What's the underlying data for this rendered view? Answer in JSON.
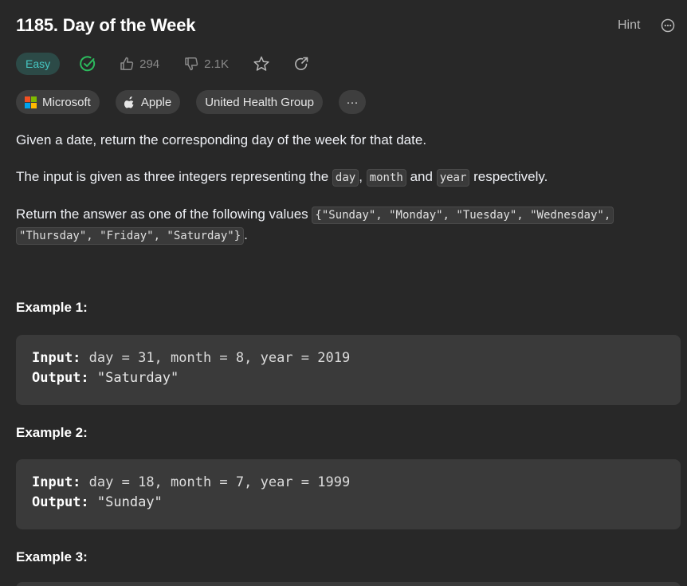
{
  "problem": {
    "title": "1185. Day of the Week",
    "hint_label": "Hint"
  },
  "meta": {
    "difficulty": "Easy",
    "likes": "294",
    "dislikes": "2.1K",
    "colors": {
      "easy_bg": "#2c4a47",
      "easy_text": "#46c6c2",
      "solved": "#2cbb5d"
    }
  },
  "companies": [
    {
      "label": "Microsoft",
      "icon": "microsoft-logo-icon"
    },
    {
      "label": "Apple",
      "icon": "apple-logo-icon"
    },
    {
      "label": "United Health Group",
      "icon": ""
    }
  ],
  "more_tags_label": "···",
  "description": {
    "p1": "Given a date, return the corresponding day of the week for that date.",
    "p2_prefix": "The input is given as three integers representing the",
    "p2_code1": "day",
    "p2_sep1": ",",
    "p2_code2": "month",
    "p2_sep2": "and",
    "p2_code3": "year",
    "p2_suffix": "respectively.",
    "p3_prefix": "Return the answer as one of the following values",
    "p3_code_line1": "{\"Sunday\", \"Monday\", \"Tuesday\", \"Wednesday\",",
    "p3_code_line2": "\"Thursday\", \"Friday\", \"Saturday\"}",
    "p3_suffix": "."
  },
  "examples": [
    {
      "title": "Example 1:",
      "input_label": "Input:",
      "input": "day = 31, month = 8, year = 2019",
      "output_label": "Output:",
      "output": "\"Saturday\""
    },
    {
      "title": "Example 2:",
      "input_label": "Input:",
      "input": "day = 18, month = 7, year = 1999",
      "output_label": "Output:",
      "output": "\"Sunday\""
    },
    {
      "title": "Example 3:"
    }
  ]
}
